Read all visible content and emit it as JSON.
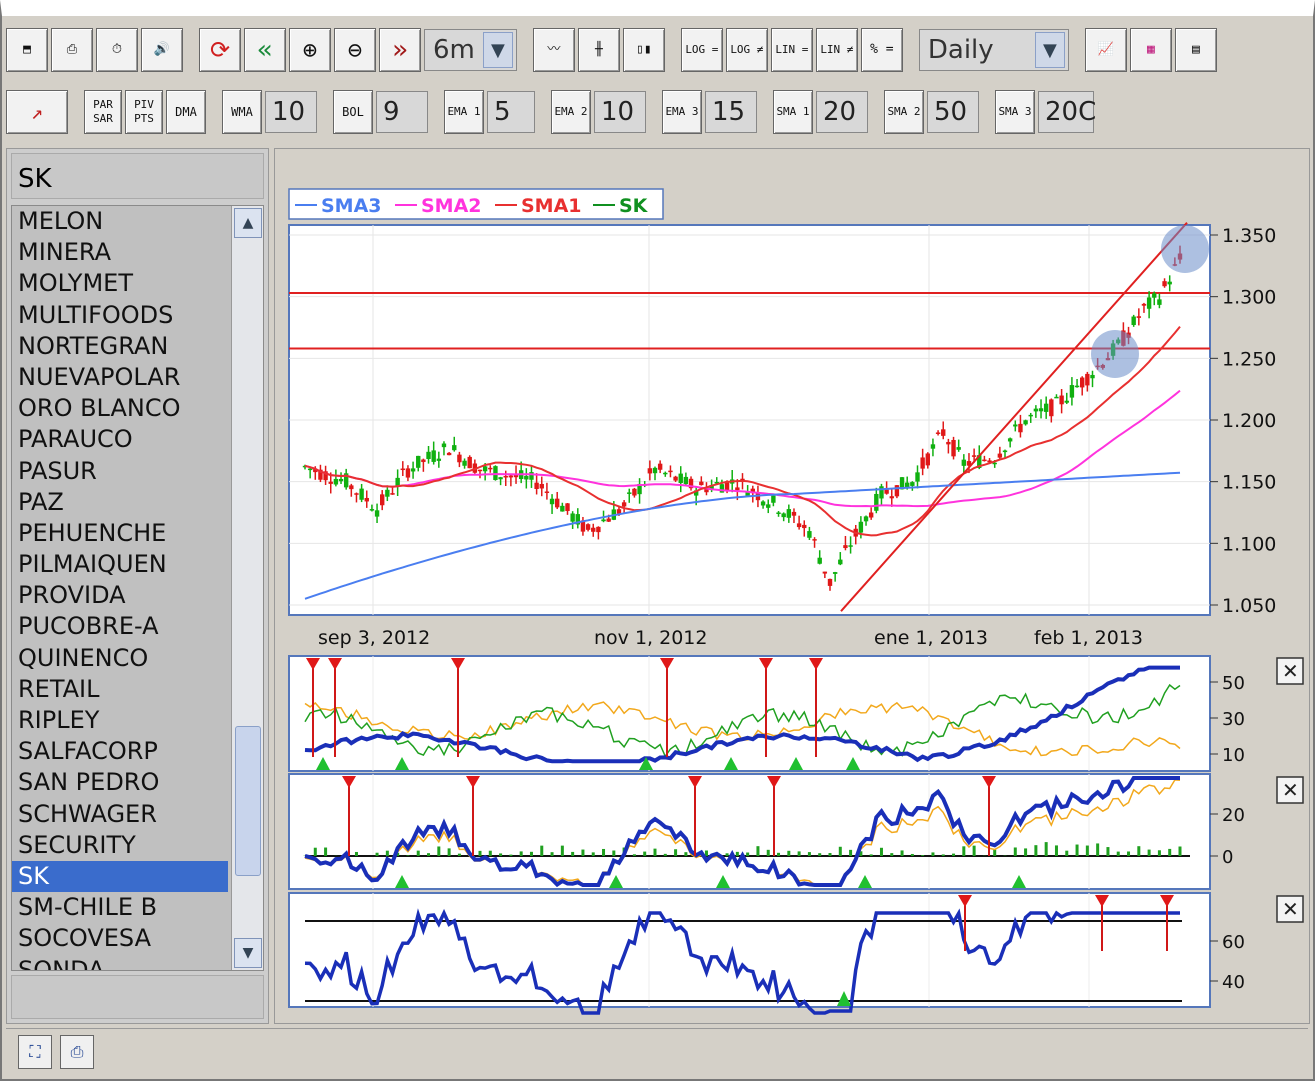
{
  "toolbar1": {
    "buttons": [
      {
        "name": "layout-window-icon",
        "glyph": "⬒"
      },
      {
        "name": "print-setup-icon",
        "glyph": "⎙"
      },
      {
        "name": "timer-icon",
        "glyph": "⏱"
      },
      {
        "name": "speaker-icon",
        "glyph": "🔊"
      },
      {
        "name": "refresh-icon",
        "glyph": "⟳"
      },
      {
        "name": "rewind-icon",
        "glyph": "«"
      },
      {
        "name": "zoom-in-icon",
        "glyph": "⊕"
      },
      {
        "name": "zoom-out-icon",
        "glyph": "⊖"
      },
      {
        "name": "forward-icon",
        "glyph": "»"
      }
    ],
    "period": "6m",
    "chart_types": [
      {
        "name": "line-chart-icon",
        "glyph": "〰"
      },
      {
        "name": "bar-chart-icon",
        "glyph": "╫"
      },
      {
        "name": "candlestick-icon",
        "glyph": "▯▮"
      }
    ],
    "scales": [
      "LOG =",
      "LOG ≠",
      "LIN =",
      "LIN ≠",
      "% ="
    ],
    "interval": "Daily",
    "right_buttons": [
      {
        "name": "chart-settings-icon",
        "glyph": "📈"
      },
      {
        "name": "color-palette-icon",
        "glyph": "▦"
      },
      {
        "name": "indicator-panel-icon",
        "glyph": "▤"
      }
    ]
  },
  "toolbar2": {
    "draw_button": "↗",
    "par_sar": "PAR SAR",
    "piv_pts": "PIV PTS",
    "dma": "DMA",
    "wma": {
      "label": "WMA",
      "value": "10"
    },
    "bol": {
      "label": "BOL",
      "value": "9"
    },
    "ema1": {
      "label": "EMA 1",
      "value": "5"
    },
    "ema2": {
      "label": "EMA 2",
      "value": "10"
    },
    "ema3": {
      "label": "EMA 3",
      "value": "15"
    },
    "sma1": {
      "label": "SMA 1",
      "value": "20"
    },
    "sma2": {
      "label": "SMA 2",
      "value": "50"
    },
    "sma3": {
      "label": "SMA 3",
      "value": "20C"
    }
  },
  "sidebar": {
    "title": "SK",
    "items": [
      "MELON",
      "MINERA",
      "MOLYMET",
      "MULTIFOODS",
      "NORTEGRAN",
      "NUEVAPOLAR",
      "ORO BLANCO",
      "PARAUCO",
      "PASUR",
      "PAZ",
      "PEHUENCHE",
      "PILMAIQUEN",
      "PROVIDA",
      "PUCOBRE-A",
      "QUINENCO",
      "RETAIL",
      "RIPLEY",
      "SALFACORP",
      "SAN PEDRO",
      "SCHWAGER",
      "SECURITY",
      "SK",
      "SM-CHILE B",
      "SOCOVESA",
      "SONDA"
    ],
    "selected": "SK"
  },
  "chart": {
    "legend": [
      "SMA3",
      "SMA2",
      "SMA1",
      "SK"
    ],
    "colors": {
      "sma3": "#4a7ef0",
      "sma2": "#ff33dd",
      "sma1": "#e83030",
      "sk": "#109020",
      "up": "#10b010",
      "down": "#e01818"
    },
    "price_ticks": [
      "1.350",
      "1.300",
      "1.250",
      "1.200",
      "1.150",
      "1.100",
      "1.050"
    ],
    "date_ticks": [
      "sep 3, 2012",
      "nov 1, 2012",
      "ene 1, 2013",
      "feb 1, 2013"
    ],
    "ind1_ticks": [
      "50",
      "30",
      "10"
    ],
    "ind2_ticks": [
      "20",
      "0"
    ],
    "ind3_ticks": [
      "60",
      "40"
    ],
    "close_icon": "✕"
  },
  "chart_data": {
    "type": "line",
    "title": "",
    "x": [
      "2012-08-17",
      "2012-09-03",
      "2012-10-01",
      "2012-11-01",
      "2012-12-01",
      "2013-01-01",
      "2013-02-01",
      "2013-02-20"
    ],
    "series": [
      {
        "name": "SK",
        "values": [
          1165,
          1140,
          1150,
          1135,
          1110,
          1150,
          1250,
          1330
        ]
      },
      {
        "name": "SMA1",
        "values": [
          1165,
          1155,
          1150,
          1140,
          1115,
          1130,
          1220,
          1260
        ]
      },
      {
        "name": "SMA2",
        "values": [
          1170,
          1170,
          1160,
          1150,
          1130,
          1135,
          1160,
          1195
        ]
      },
      {
        "name": "SMA3",
        "values": [
          1050,
          1065,
          1090,
          1115,
          1135,
          1140,
          1150,
          1155
        ]
      }
    ],
    "ylim": [
      1050,
      1350
    ],
    "horizontal_lines": [
      1303,
      1258
    ]
  }
}
